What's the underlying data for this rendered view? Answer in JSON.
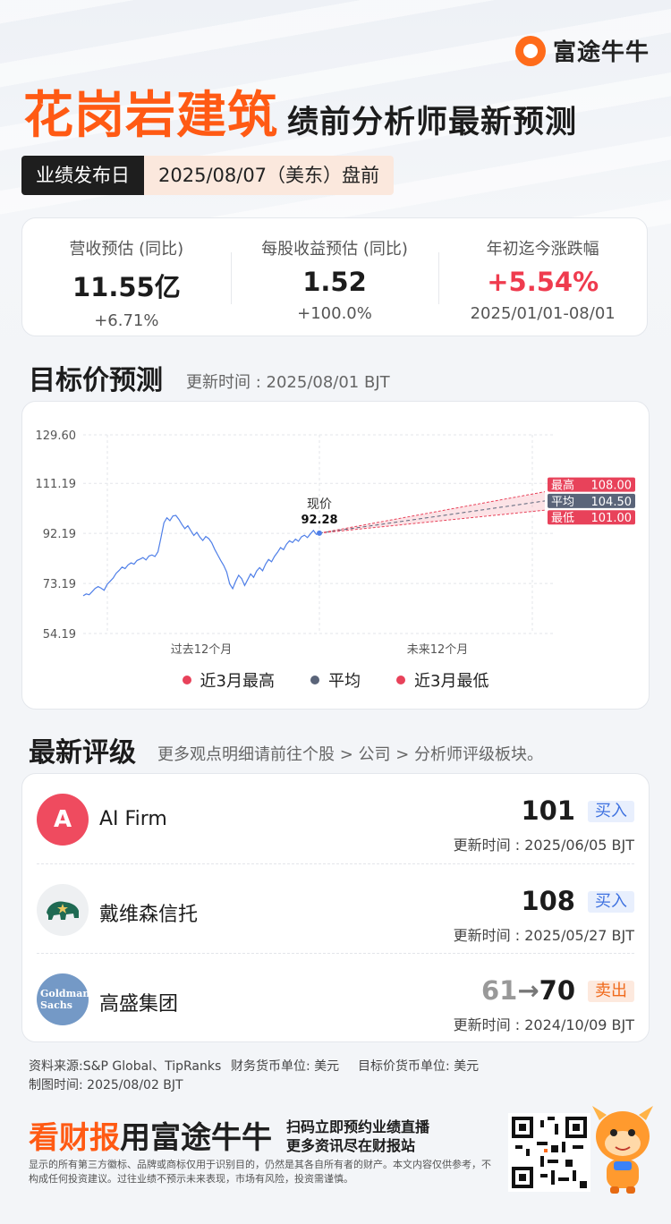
{
  "brand": {
    "name": "富途牛牛"
  },
  "title": {
    "company": "花岗岩建筑",
    "subtitle": "绩前分析师最新预测"
  },
  "release": {
    "label": "业绩发布日",
    "value": "2025/08/07（美东）盘前"
  },
  "stats": [
    {
      "label": "营收预估 (同比)",
      "value": "11.55亿",
      "sub": "+6.71%"
    },
    {
      "label": "每股收益预估 (同比)",
      "value": "1.52",
      "sub": "+100.0%"
    },
    {
      "label": "年初迄今涨跌幅",
      "value": "+5.54%",
      "sub": "2025/01/01-08/01"
    }
  ],
  "target_section": {
    "title": "目标价预测",
    "updated": "更新时间 : 2025/08/01 BJT"
  },
  "chart_data": {
    "type": "line",
    "y_ticks": [
      "129.60",
      "111.19",
      "92.19",
      "73.19",
      "54.19"
    ],
    "ylim": [
      54.19,
      129.6
    ],
    "x_labels": [
      "过去12个月",
      "未来12个月"
    ],
    "current": {
      "label": "现价",
      "value": "92.28"
    },
    "price_history": [
      68.5,
      69.2,
      68.9,
      70.1,
      71.3,
      72.0,
      71.4,
      70.6,
      72.8,
      74.0,
      75.2,
      77.0,
      78.1,
      79.4,
      78.8,
      80.2,
      81.0,
      80.5,
      81.9,
      82.4,
      83.0,
      82.1,
      83.6,
      84.0,
      83.4,
      85.2,
      90.5,
      96.2,
      98.1,
      97.0,
      98.8,
      99.0,
      97.5,
      95.6,
      94.0,
      95.1,
      93.2,
      91.4,
      92.6,
      90.8,
      89.5,
      91.0,
      90.2,
      88.6,
      86.1,
      84.0,
      81.9,
      80.0,
      77.5,
      73.0,
      71.2,
      74.0,
      76.3,
      75.0,
      72.4,
      74.6,
      76.8,
      75.5,
      77.9,
      79.2,
      78.0,
      80.5,
      82.3,
      81.4,
      83.5,
      85.0,
      86.8,
      86.0,
      88.1,
      89.4,
      88.7,
      90.0,
      89.2,
      90.9,
      91.5,
      90.6,
      92.0,
      93.3,
      91.8,
      92.28
    ],
    "forecast": {
      "high": {
        "label": "最高",
        "value": "108.00"
      },
      "avg": {
        "label": "平均",
        "value": "104.50"
      },
      "low": {
        "label": "最低",
        "value": "101.00"
      }
    },
    "legend": [
      "近3月最高",
      "平均",
      "近3月最低"
    ],
    "colors": {
      "high": "#e8425a",
      "avg": "#5a6479",
      "low": "#e8425a",
      "line": "#4f7fe8"
    }
  },
  "rating_section": {
    "title": "最新评级",
    "note": "更多观点明细请前往个股 > 公司 > 分析师评级板块。"
  },
  "ratings": [
    {
      "avatar": "A",
      "firm": "AI Firm",
      "old": "",
      "target": "101",
      "rating": "买入",
      "updated": "更新时间 : 2025/06/05 BJT"
    },
    {
      "avatar": "",
      "firm": "戴维森信托",
      "old": "",
      "target": "108",
      "rating": "买入",
      "updated": "更新时间 : 2025/05/27 BJT"
    },
    {
      "avatar": "Goldman Sachs",
      "firm": "高盛集团",
      "old": "61",
      "target": "70",
      "rating": "卖出",
      "updated": "更新时间 : 2024/10/09 BJT"
    }
  ],
  "footer": {
    "source": "资料来源:S&P Global、TipRanks",
    "currency": "财务货币单位: 美元",
    "target_currency": "目标价货币单位: 美元",
    "made": "制图时间: 2025/08/02 BJT",
    "promo_a": "看财报",
    "promo_b": "用富途牛牛",
    "promo_line1": "扫码立即预约业绩直播",
    "promo_line2": "更多资讯尽在财报站",
    "disclaimer": "显示的所有第三方徽标、品牌或商标仅用于识别目的，仍然是其各自所有者的财产。本文内容仅供参考，不构成任何投资建议。过往业绩不预示未来表现，市场有风险，投资需谨慎。"
  }
}
